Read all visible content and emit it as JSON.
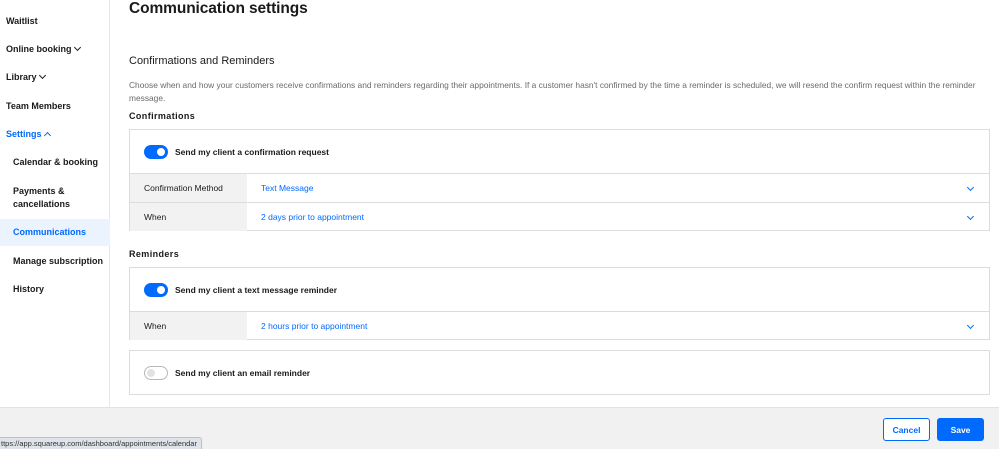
{
  "sidebar": {
    "items": [
      {
        "label": "Waitlist"
      },
      {
        "label": "Online booking"
      },
      {
        "label": "Library"
      },
      {
        "label": "Team Members"
      },
      {
        "label": "Settings"
      },
      {
        "label": "Calendar & booking"
      },
      {
        "label": "Payments &"
      },
      {
        "label": "cancellations"
      },
      {
        "label": "Communications"
      },
      {
        "label": "Manage subscription"
      },
      {
        "label": "History"
      }
    ],
    "active": "Communications"
  },
  "page": {
    "title": "Communication settings",
    "section_title": "Confirmations and Reminders",
    "description": "Choose when and how your customers receive confirmations and reminders regarding their appointments. If a customer hasn't confirmed by the time a reminder is scheduled, we will resend the confirm request within the reminder message."
  },
  "confirmations": {
    "heading": "Confirmations",
    "toggle_label": "Send my client a confirmation request",
    "toggle_on": true,
    "method_label": "Confirmation Method",
    "method_value": "Text Message",
    "when_label": "When",
    "when_value": "2 days prior to appointment"
  },
  "reminders": {
    "heading": "Reminders",
    "text_toggle_label": "Send my client a text message reminder",
    "text_toggle_on": true,
    "when_label": "When",
    "when_value": "2 hours prior to appointment",
    "email_toggle_label": "Send my client an email reminder",
    "email_toggle_on": false
  },
  "footer": {
    "cancel_label": "Cancel",
    "save_label": "Save"
  },
  "status_bar": {
    "url": "ttps://app.squareup.com/dashboard/appointments/calendar"
  },
  "colors": {
    "accent": "#006aff",
    "active_bg": "#ebf3ff"
  }
}
